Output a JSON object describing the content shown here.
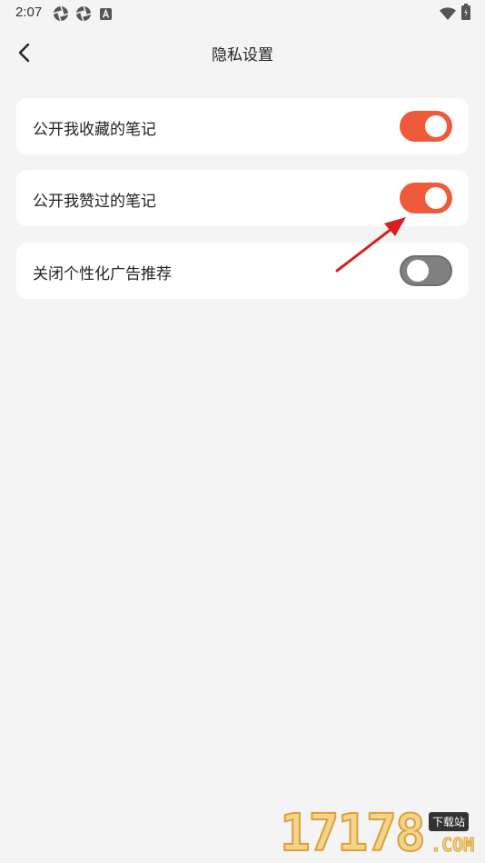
{
  "status_bar": {
    "time": "2:07",
    "icons": [
      "aperture-icon",
      "aperture-icon",
      "a-notification-icon",
      "wifi-icon",
      "battery-icon"
    ]
  },
  "nav": {
    "back_icon": "chevron-left-icon",
    "title": "隐私设置"
  },
  "settings": [
    {
      "label": "公开我收藏的笔记",
      "enabled": true
    },
    {
      "label": "公开我赞过的笔记",
      "enabled": true
    },
    {
      "label": "关闭个性化广告推荐",
      "enabled": false
    }
  ],
  "colors": {
    "accent": "#ee5a3a",
    "toggle_off": "#808080",
    "background": "#f4f4f4",
    "card": "#ffffff",
    "annotation_arrow": "#d81e1e"
  },
  "watermark": {
    "number": "17178",
    "badge": "下载站",
    "domain": ".COM"
  }
}
